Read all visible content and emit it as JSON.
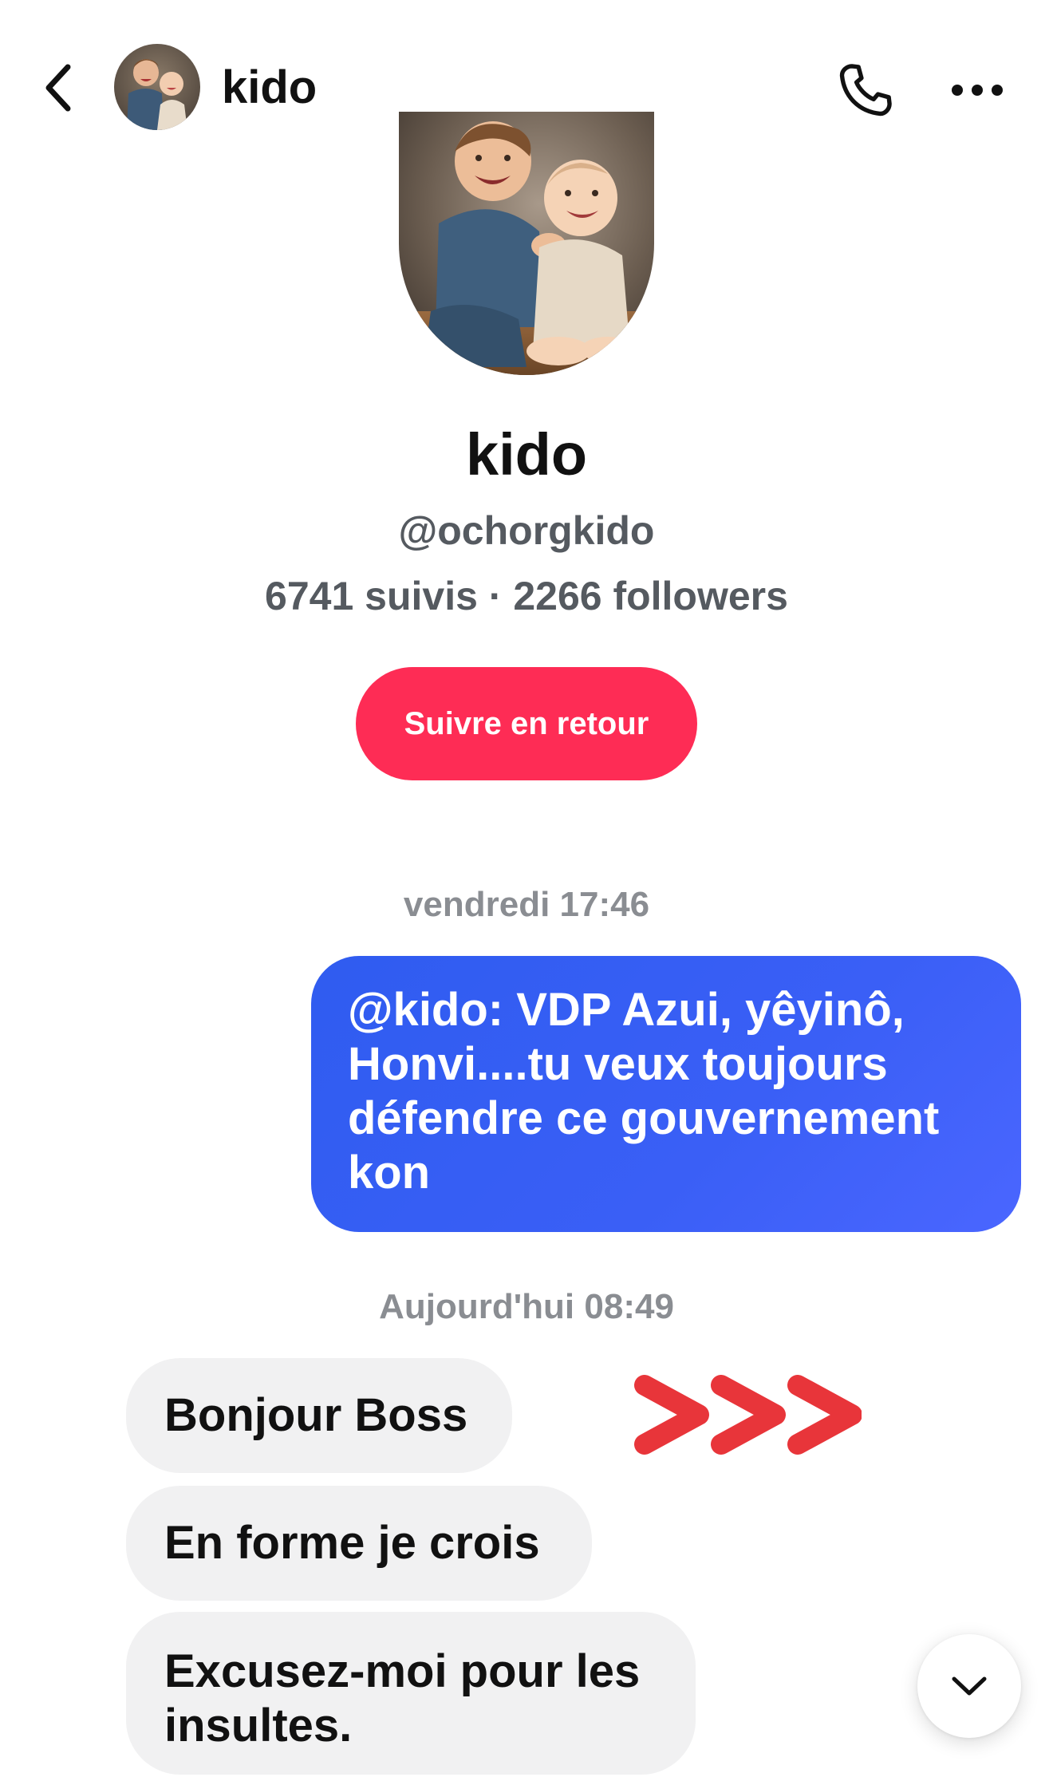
{
  "header": {
    "back_icon": "chevron-left-icon",
    "avatar_icon": "avatar-photo",
    "name": "kido",
    "call_icon": "phone-icon",
    "more_icon": "more-horizontal-icon"
  },
  "profile": {
    "name": "kido",
    "handle": "@ochorgkido",
    "stats": "6741 suivis · 2266 followers",
    "follow_button_label": "Suivre en retour",
    "follow_button_color": "#fe2c55"
  },
  "messages": [
    {
      "timestamp": "vendredi 17:46"
    },
    {
      "direction": "outgoing",
      "text": "@kido: VDP Azui, yêyinô, Honvi....tu veux toujours défendre ce gouvernement kon",
      "color": "#3a5ff6"
    },
    {
      "timestamp": "Aujourd'hui 08:49"
    },
    {
      "direction": "incoming",
      "text": "Bonjour Boss"
    },
    {
      "direction": "incoming",
      "text": "En forme je crois"
    },
    {
      "direction": "incoming",
      "text": "Excusez-moi pour les insultes."
    }
  ],
  "annotation": {
    "icon": "red-triple-chevron-arrows",
    "color": "#e8353a"
  },
  "scroll_down_icon": "chevron-down-icon"
}
